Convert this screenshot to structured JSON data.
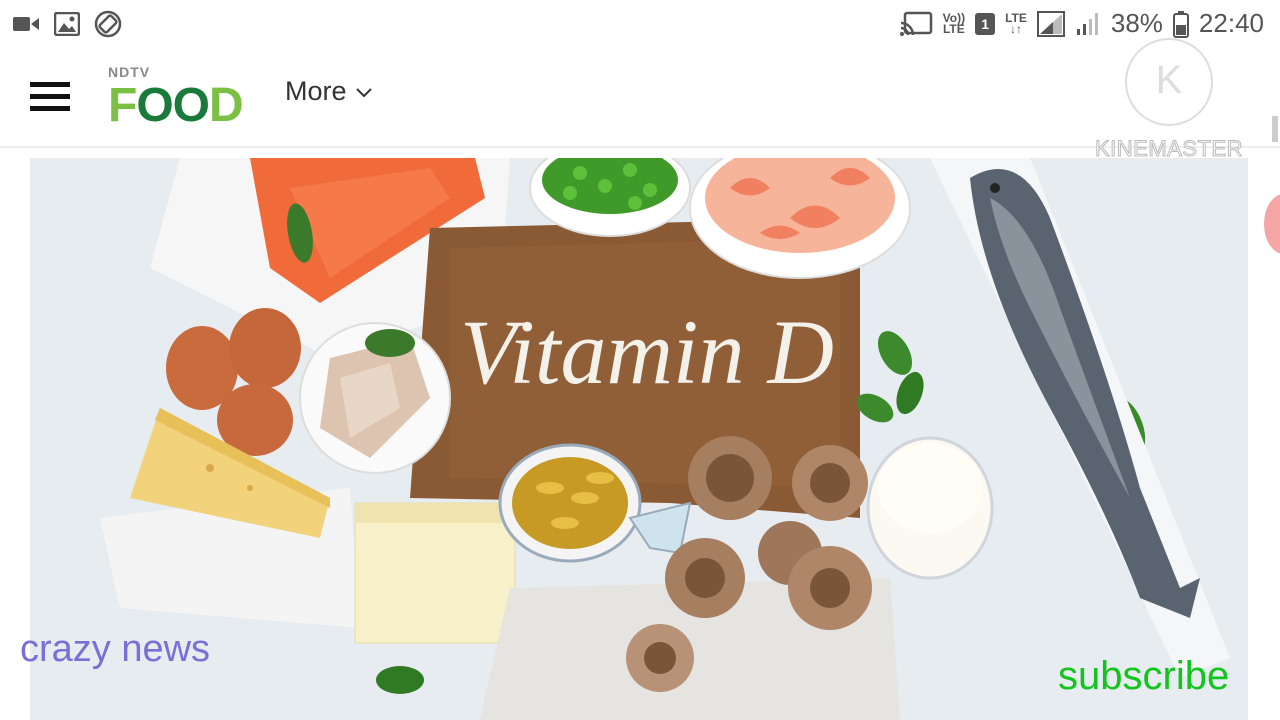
{
  "status_bar": {
    "volte_top": "Vo))",
    "volte_bottom": "LTE",
    "sim_slot": "1",
    "lte_label": "LTE",
    "battery": "38%",
    "time": "22:40"
  },
  "header": {
    "logo_top": "NDTV",
    "logo_main_prefix": "F",
    "logo_main_mid": "OO",
    "logo_main_suffix": "D",
    "more_label": "More"
  },
  "watermark": {
    "letter": "K",
    "text": "KINEMASTER"
  },
  "hero": {
    "board_text": "Vitamin D"
  },
  "overlays": {
    "left_text": "crazy news",
    "right_text": "subscribe"
  },
  "colors": {
    "logo_green": "#7bc043",
    "logo_dark_green": "#1a7a3a",
    "overlay_purple": "#7a6fd6",
    "overlay_green": "#12c41c"
  }
}
